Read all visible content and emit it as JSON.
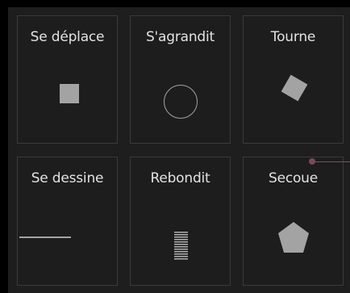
{
  "cards": [
    {
      "label": "Se déplace",
      "icon": "square-icon"
    },
    {
      "label": "S'agrandit",
      "icon": "circle-icon"
    },
    {
      "label": "Tourne",
      "icon": "rotated-square-icon"
    },
    {
      "label": "Se dessine",
      "icon": "line-icon"
    },
    {
      "label": "Rebondit",
      "icon": "striped-bar-icon"
    },
    {
      "label": "Secoue",
      "icon": "pentagon-icon"
    }
  ],
  "colors": {
    "background": "#000000",
    "panel": "#1e1e1e",
    "card": "#1d1d1d",
    "card_border": "#3a3a3a",
    "text": "#e2e2e2",
    "shape": "#a3a3a3",
    "accent": "#8a4a58"
  }
}
